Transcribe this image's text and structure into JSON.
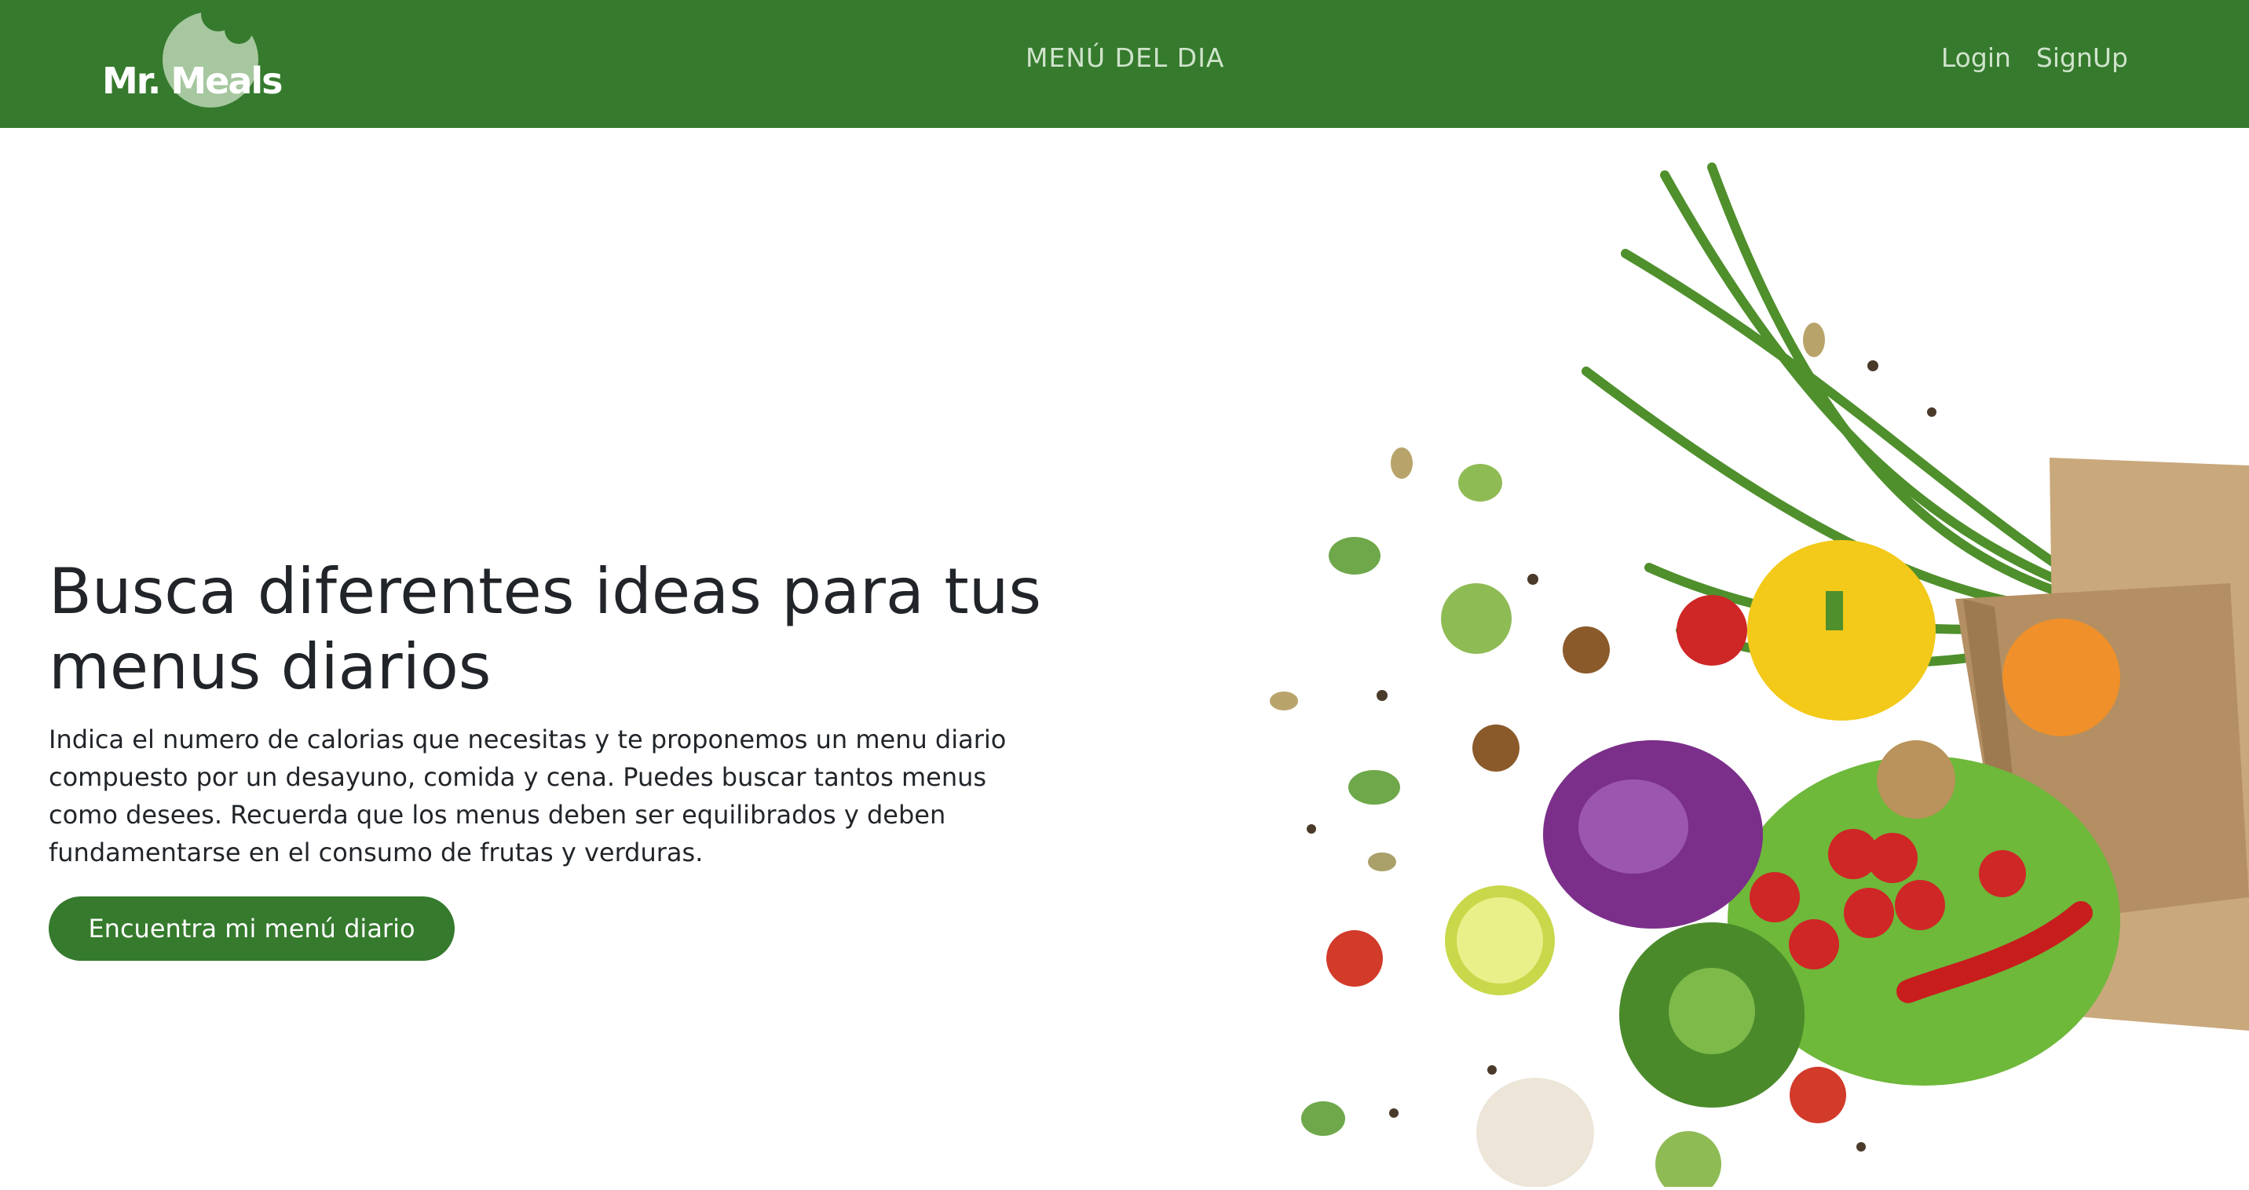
{
  "brand": {
    "name": "Mr. Meals",
    "color": "#357a2d"
  },
  "nav": {
    "center_link": "MENÚ DEL DIA",
    "login": "Login",
    "signup": "SignUp"
  },
  "hero": {
    "title": "Busca diferentes ideas para tus menus diarios",
    "description": "Indica el numero de calorias que necesitas y te proponemos un menu diario compuesto por un desayuno, comida y cena. Puedes buscar tantos menus como desees. Recuerda que los menus deben ser equilibrados y deben fundamentarse en el consumo de frutas y verduras.",
    "cta_label": "Encuentra mi menú diario",
    "image": "vegetables-grocery-bag-photo"
  }
}
